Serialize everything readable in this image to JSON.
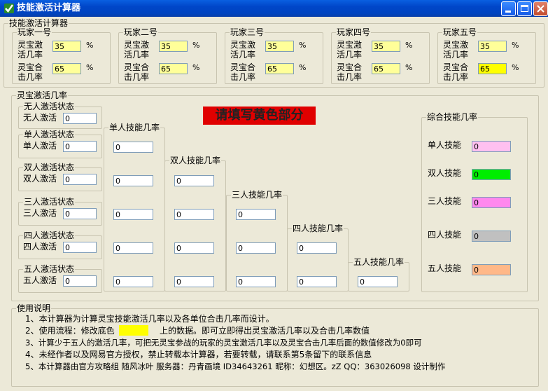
{
  "window": {
    "title": "技能激活计算器"
  },
  "top_group": {
    "title": "技能激活计算器"
  },
  "players": [
    {
      "name": "玩家一号",
      "rate_label": "灵宝激活几率",
      "rate": "35",
      "crit_label": "灵宝合击几率",
      "crit": "65"
    },
    {
      "name": "玩家二号",
      "rate_label": "灵宝激活几率",
      "rate": "35",
      "crit_label": "灵宝合击几率",
      "crit": "65"
    },
    {
      "name": "玩家三号",
      "rate_label": "灵宝激活几率",
      "rate": "35",
      "crit_label": "灵宝合击几率",
      "crit": "65"
    },
    {
      "name": "玩家四号",
      "rate_label": "灵宝激活几率",
      "rate": "35",
      "crit_label": "灵宝合击几率",
      "crit": "65"
    },
    {
      "name": "玩家五号",
      "rate_label": "灵宝激活几率",
      "rate": "35",
      "crit_label": "灵宝合击几率",
      "crit": "65"
    }
  ],
  "percent": "%",
  "activation": {
    "title": "灵宝激活几率",
    "notice": "请填写黄色部分",
    "states": [
      {
        "group": "无人激活状态",
        "label": "无人激活",
        "value": "0"
      },
      {
        "group": "单人激活状态",
        "label": "单人激活",
        "value": "0"
      },
      {
        "group": "双人激活状态",
        "label": "双人激活",
        "value": "0"
      },
      {
        "group": "三人激活状态",
        "label": "三人激活",
        "value": "0"
      },
      {
        "group": "四人激活状态",
        "label": "四人激活",
        "value": "0"
      },
      {
        "group": "五人激活状态",
        "label": "五人激活",
        "value": "0"
      }
    ],
    "skill_columns": [
      {
        "title": "单人技能几率",
        "values": [
          "0",
          "0",
          "0",
          "0",
          "0"
        ]
      },
      {
        "title": "双人技能几率",
        "values": [
          "0",
          "0",
          "0",
          "0"
        ]
      },
      {
        "title": "三人技能几率",
        "values": [
          "0",
          "0",
          "0"
        ]
      },
      {
        "title": "四人技能几率",
        "values": [
          "0",
          "0"
        ]
      },
      {
        "title": "五人技能几率",
        "values": [
          "0"
        ]
      }
    ]
  },
  "summary": {
    "title": "综合技能几率",
    "rows": [
      {
        "label": "单人技能",
        "value": "0",
        "color": "#ffc0f0"
      },
      {
        "label": "双人技能",
        "value": "0",
        "color": "#00ee00"
      },
      {
        "label": "三人技能",
        "value": "0",
        "color": "#ff88ee"
      },
      {
        "label": "四人技能",
        "value": "0",
        "color": "#c0c0c0"
      },
      {
        "label": "五人技能",
        "value": "0",
        "color": "#ffb888"
      }
    ]
  },
  "usage": {
    "title": "使用说明",
    "line1": "1、本计算器为计算灵宝技能激活几率以及各单位合击几率而设计。",
    "line2a": "2、使用流程：修改底色",
    "line2b": "上的数据。即可立即得出灵宝激活几率以及合击几率数值",
    "line2_color": "#ffff00",
    "line3": "3、计算少于五人的激活几率，可把无灵宝参战的玩家的灵宝激活几率以及灵宝合击几率后面的数值修改为0即可",
    "line4": "4、未经作者以及网易官方授权，禁止转载本计算器，若要转载，请联系第5条留下的联系信息",
    "line5": "5、本计算器由官方攻略组 随风冰叶    服务器：丹青画境    ID34643261    昵称：幻想区。zZ    QQ：363026098  设计制作"
  }
}
